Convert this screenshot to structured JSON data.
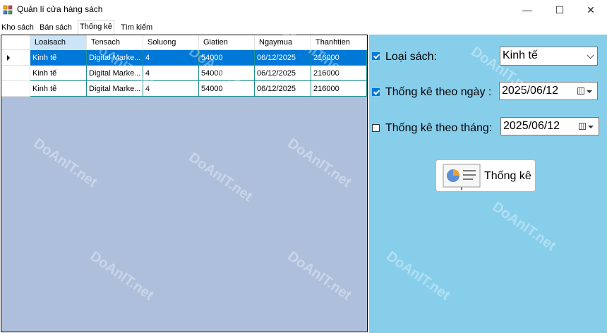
{
  "window": {
    "title": "Quản lí cửa hàng sách",
    "minimize_glyph": "—",
    "maximize_glyph": "☐",
    "close_glyph": "✕"
  },
  "tabs": [
    {
      "label": "Kho sách",
      "active": false
    },
    {
      "label": "Bán sách",
      "active": false
    },
    {
      "label": "Thống kê",
      "active": true
    },
    {
      "label": "Tìm kiếm",
      "active": false
    }
  ],
  "grid": {
    "columns": [
      "Loaisach",
      "Tensach",
      "Soluong",
      "Giatien",
      "Ngaymua",
      "Thanhtien"
    ],
    "rows": [
      [
        "Kinh tế",
        "Digital Marke...",
        "4",
        "54000",
        "06/12/2025",
        "216000"
      ],
      [
        "Kinh tế",
        "Digital Marke...",
        "4",
        "54000",
        "06/12/2025",
        "216000"
      ],
      [
        "Kinh tế",
        "Digital Marke...",
        "4",
        "54000",
        "06/12/2025",
        "216000"
      ]
    ],
    "selected_row": 0
  },
  "filters": {
    "category": {
      "label": "Loại sách:",
      "checked": true,
      "value": "Kinh tế"
    },
    "by_day": {
      "label": "Thống kê theo ngày :",
      "checked": true,
      "value": "2025/06/12"
    },
    "by_month": {
      "label": "Thống kê theo tháng:",
      "checked": false,
      "value": "2025/06/12"
    }
  },
  "stats_button": {
    "label": "Thống kê"
  },
  "watermark": "DoAnIT.net",
  "colors": {
    "grid_bg": "#aebfdc",
    "right_panel_bg": "#87ceeb",
    "selection": "#0078d7",
    "grid_lines": "#1e8e8e"
  }
}
